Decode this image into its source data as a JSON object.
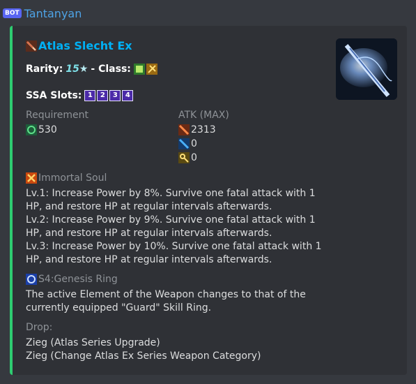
{
  "header": {
    "bot_tag": "BOT",
    "author": "Tantanyan"
  },
  "embed": {
    "title": "Atlas Slecht Ex",
    "rarity_label": "Rarity:",
    "rarity_value": "15",
    "class_label": "- Class:",
    "ssa_label": "SSA Slots:",
    "ssa_slots": [
      "1",
      "2",
      "3",
      "4"
    ],
    "requirement_label": "Requirement",
    "requirement_value": "530",
    "atk_label": "ATK (MAX)",
    "atk_values": [
      "2313",
      "0",
      "0"
    ],
    "potential_name": "Immortal Soul",
    "potential_lines": [
      "Lv.1: Increase Power by 8%. Survive one fatal attack with 1 HP, and restore HP at regular intervals afterwards.",
      "Lv.2: Increase Power by 9%. Survive one fatal attack with 1 HP, and restore HP at regular intervals afterwards.",
      "Lv.3: Increase Power by 10%. Survive one fatal attack with 1 HP, and restore HP at regular intervals afterwards."
    ],
    "s4_name": "S4:Genesis Ring",
    "s4_text": "The active Element of the Weapon changes to that of the currently equipped \"Guard\" Skill Ring.",
    "drop_label": "Drop:",
    "drop_items": [
      "Zieg (Atlas Series Upgrade)",
      "Zieg (Change Atlas Ex Series Weapon Category)"
    ],
    "accent_color": "#2ecc71",
    "link_color": "#00b0f4"
  }
}
